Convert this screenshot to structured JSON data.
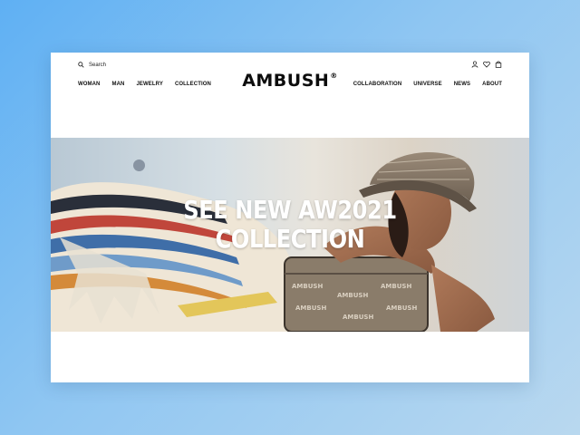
{
  "header": {
    "search_label": "Search",
    "logo_text": "AMBUSH",
    "logo_mark": "®",
    "nav_left": [
      "WOMAN",
      "MAN",
      "JEWELRY",
      "COLLECTION"
    ],
    "nav_right": [
      "COLLABORATION",
      "UNIVERSE",
      "NEWS",
      "ABOUT"
    ],
    "icons": [
      "user-icon",
      "heart-icon",
      "bag-icon"
    ]
  },
  "hero": {
    "title_line1": "SEE NEW AW2021",
    "title_line2": "COLLECTION"
  },
  "colors": {
    "background_gradient_start": "#5fb0f3",
    "background_gradient_end": "#b9d8ef",
    "text": "#0d0d0d",
    "hero_text": "#ffffff"
  }
}
